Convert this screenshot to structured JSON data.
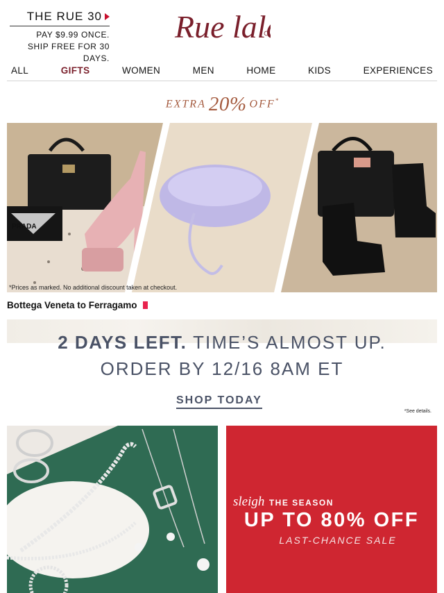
{
  "header": {
    "rue30": {
      "title": "THE RUE 30",
      "line1": "PAY $9.99 ONCE.",
      "line2": "SHIP FREE FOR 30 DAYS."
    },
    "logo_text": "Rue lala"
  },
  "nav": {
    "items": [
      "ALL",
      "GIFTS",
      "WOMEN",
      "MEN",
      "HOME",
      "KIDS",
      "EXPERIENCES"
    ]
  },
  "promo": {
    "extra_word": "EXTRA",
    "percent": "20%",
    "off_word": "OFF",
    "off_mark": "*"
  },
  "hero": {
    "note": "*Prices as marked. No additional discount taken at checkout.",
    "caption": "Bottega Veneta to Ferragamo",
    "bag_brand_label": "PRADA"
  },
  "banner": {
    "days_left": "2 DAYS LEFT.",
    "times_up": "TIME’S ALMOST UP.",
    "order_by": "ORDER BY 12/16 8AM ET",
    "cta": "SHOP TODAY",
    "see_details": "*See details."
  },
  "tiles": {
    "sale": {
      "script": "sleigh",
      "rest": "THE SEASON",
      "headline": "UP TO 80% OFF",
      "subline": "LAST-CHANCE SALE"
    }
  },
  "colors": {
    "brand": "#7a1f2b",
    "promo": "#a45a3e",
    "banner_text": "#4a5266",
    "sale_bg": "#cf2631",
    "marker": "#e8234e"
  }
}
